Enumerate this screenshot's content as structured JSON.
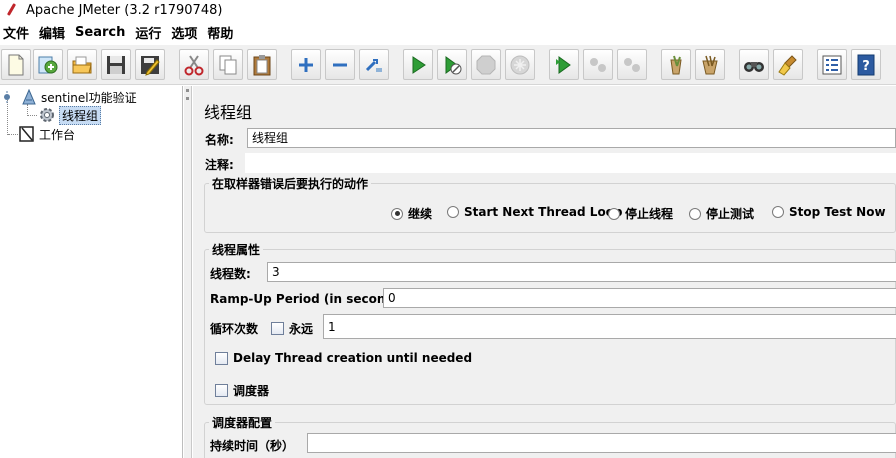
{
  "window": {
    "title": "Apache JMeter (3.2 r1790748)"
  },
  "menu": [
    {
      "label": "文件"
    },
    {
      "label": "编辑"
    },
    {
      "label": "Search"
    },
    {
      "label": "运行"
    },
    {
      "label": "选项"
    },
    {
      "label": "帮助"
    }
  ],
  "toolbar": {
    "buttons": [
      {
        "name": "new-icon"
      },
      {
        "name": "templates-icon"
      },
      {
        "name": "open-icon"
      },
      {
        "name": "save-icon"
      },
      {
        "name": "save-as-icon"
      },
      {
        "name": "cut-icon"
      },
      {
        "name": "copy-icon"
      },
      {
        "name": "paste-icon"
      },
      {
        "name": "expand-icon"
      },
      {
        "name": "collapse-icon"
      },
      {
        "name": "toggle-icon"
      },
      {
        "name": "start-icon"
      },
      {
        "name": "start-no-pauses-icon"
      },
      {
        "name": "stop-icon"
      },
      {
        "name": "shutdown-icon"
      },
      {
        "name": "remote-start-icon"
      },
      {
        "name": "remote-stop-icon"
      },
      {
        "name": "remote-shutdown-icon"
      },
      {
        "name": "clear-icon"
      },
      {
        "name": "clear-all-icon"
      },
      {
        "name": "search-icon"
      },
      {
        "name": "reset-search-icon"
      },
      {
        "name": "function-helper-icon"
      },
      {
        "name": "help-icon"
      }
    ]
  },
  "tree": {
    "nodes": [
      {
        "label": "sentinel功能验证",
        "icon": "test-plan-icon"
      },
      {
        "label": "线程组",
        "icon": "thread-group-icon",
        "selected": true
      },
      {
        "label": "工作台",
        "icon": "workbench-icon"
      }
    ]
  },
  "panel": {
    "title": "线程组",
    "name_label": "名称:",
    "name_value": "线程组",
    "comment_label": "注释:",
    "comment_value": "",
    "error_action": {
      "title": "在取样器错误后要执行的动作",
      "options": [
        {
          "label": "继续",
          "checked": true
        },
        {
          "label": "Start Next Thread Loop",
          "checked": false
        },
        {
          "label": "停止线程",
          "checked": false
        },
        {
          "label": "停止测试",
          "checked": false
        },
        {
          "label": "Stop Test Now",
          "checked": false
        }
      ]
    },
    "thread_props": {
      "title": "线程属性",
      "threads_label": "线程数:",
      "threads_value": "3",
      "rampup_label": "Ramp-Up Period (in seconds):",
      "rampup_value": "0",
      "loop_label": "循环次数",
      "forever_label": "永远",
      "forever_checked": false,
      "loop_value": "1",
      "delay_label": "Delay Thread creation until needed",
      "delay_checked": false,
      "scheduler_label": "调度器",
      "scheduler_checked": false
    },
    "scheduler_config": {
      "title": "调度器配置",
      "duration_label": "持续时间（秒）",
      "duration_value": ""
    }
  }
}
